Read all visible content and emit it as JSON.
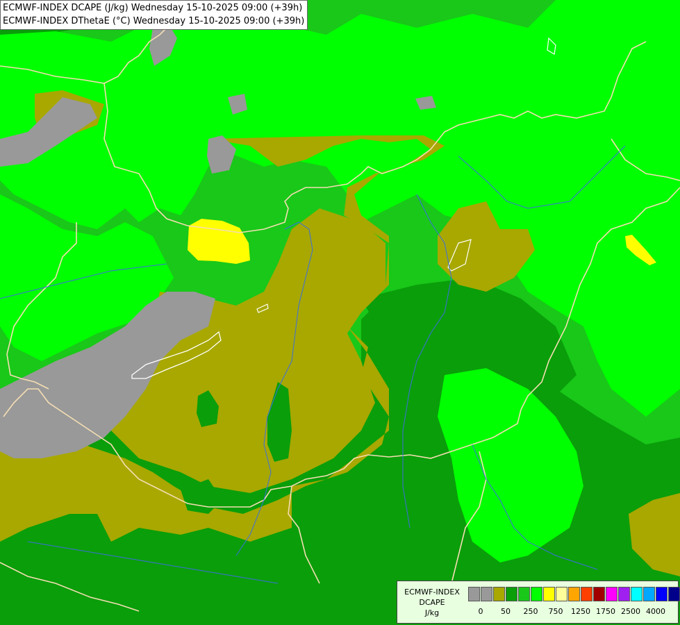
{
  "title": {
    "line1": "ECMWF-INDEX DCAPE (J/kg) Wednesday 15-10-2025 09:00 (+39h)",
    "line2": "ECMWF-INDEX DThetaE (°C) Wednesday 15-10-2025 09:00 (+39h)"
  },
  "legend": {
    "title_line1": "ECMWF-INDEX",
    "title_line2": "DCAPE",
    "units": "J/kg",
    "colors": [
      "#999999",
      "#999999",
      "#a8a800",
      "#0a9e0a",
      "#19c819",
      "#00ff00",
      "#ffff00",
      "#ffff99",
      "#ffa500",
      "#ff4000",
      "#a00000",
      "#ff00ff",
      "#a020f0",
      "#00ffff",
      "#00a8ff",
      "#0000ff",
      "#00008b"
    ],
    "tick_labels": [
      {
        "text": "0",
        "slot": 1
      },
      {
        "text": "50",
        "slot": 3
      },
      {
        "text": "250",
        "slot": 5
      },
      {
        "text": "750",
        "slot": 7
      },
      {
        "text": "1250",
        "slot": 9
      },
      {
        "text": "1750",
        "slot": 11
      },
      {
        "text": "2500",
        "slot": 13
      },
      {
        "text": "4000",
        "slot": 15
      }
    ]
  },
  "palette": {
    "dark_green": "#0a9e0a",
    "mid_green": "#19c819",
    "bright_green": "#00ff00",
    "olive": "#a8a800",
    "grey": "#999999",
    "yellow": "#ffff00",
    "border_line": "#f5deb3",
    "river_line": "#3d6fe0"
  }
}
